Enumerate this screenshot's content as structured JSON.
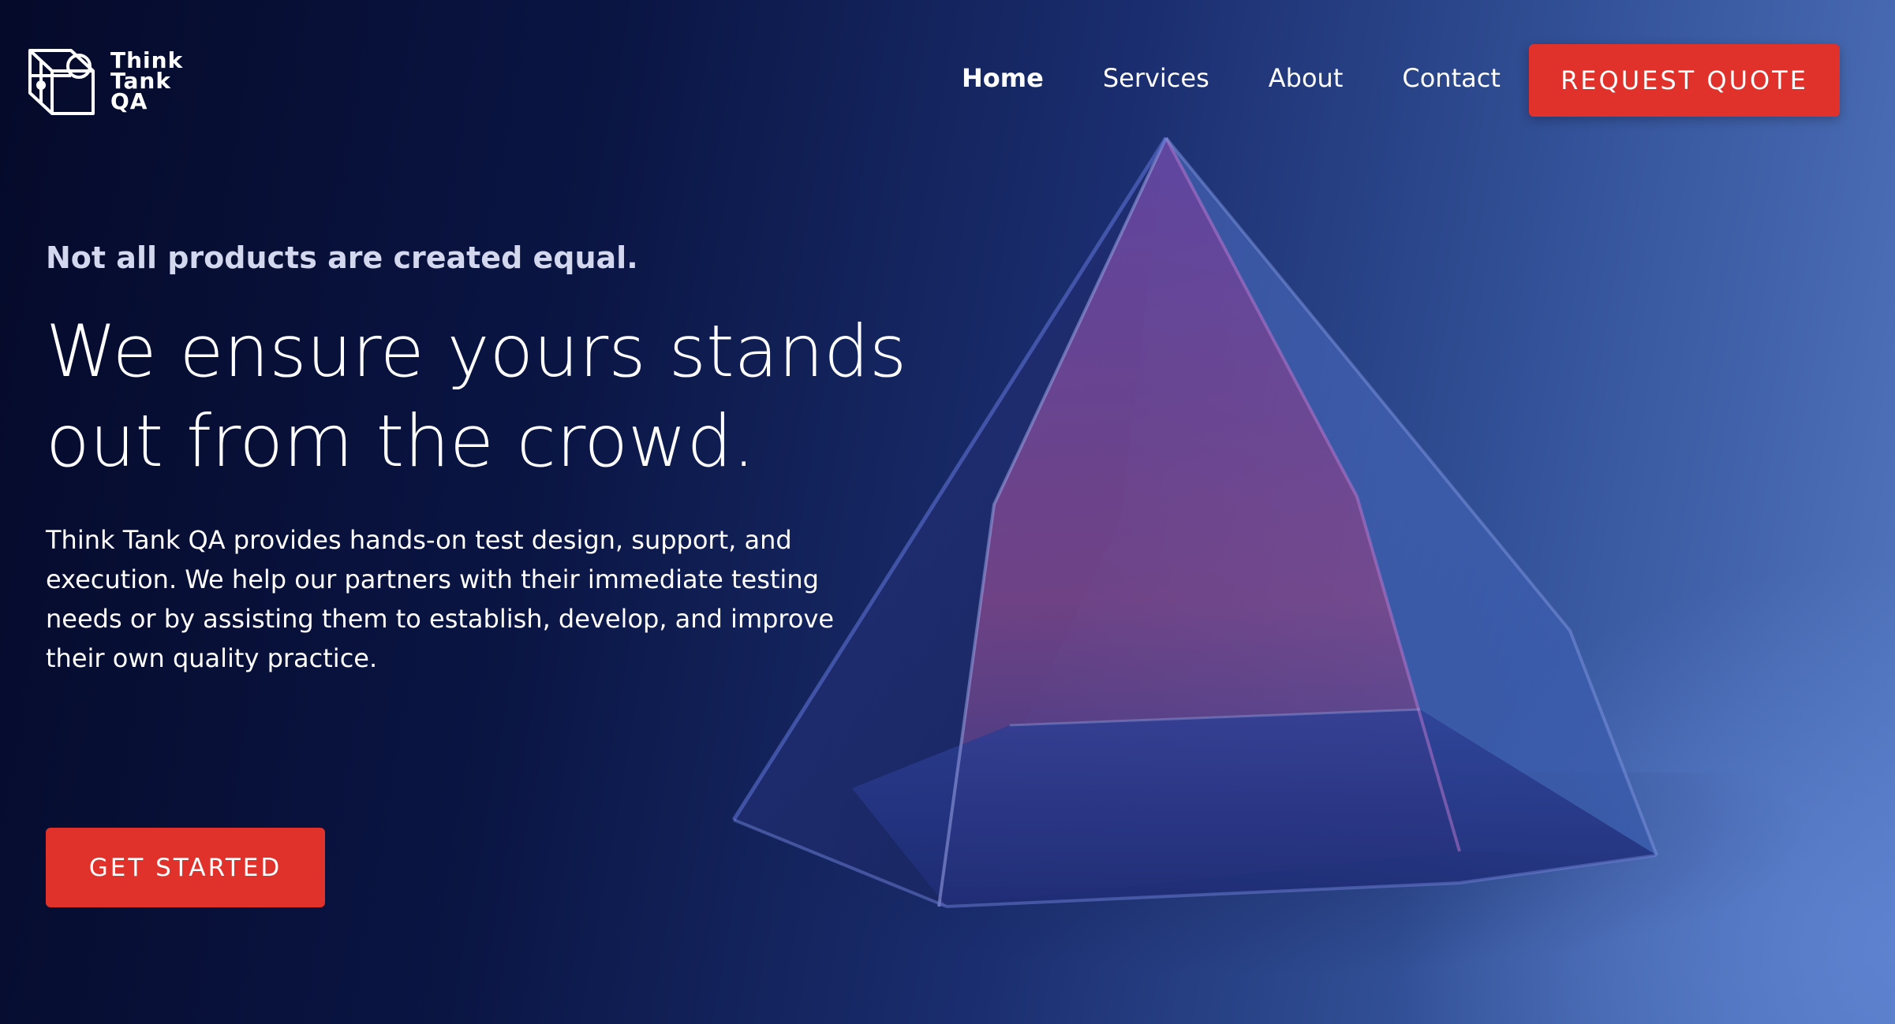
{
  "brand": {
    "name_lines": [
      "Think",
      "Tank",
      "QA"
    ],
    "logo_icon": "cube-logo-icon"
  },
  "nav": {
    "items": [
      {
        "label": "Home",
        "active": true
      },
      {
        "label": "Services",
        "active": false
      },
      {
        "label": "About",
        "active": false
      },
      {
        "label": "Contact",
        "active": false
      }
    ],
    "cta_label": "REQUEST QUOTE"
  },
  "hero": {
    "kicker": "Not all products are created equal.",
    "headline_lines": [
      "We ensure yours stands",
      "out from the crowd."
    ],
    "description": "Think Tank QA provides hands-on test design, support, and execution. We help our partners with their immediate testing needs or by assisting them to establish, develop, and improve their own quality practice.",
    "cta_label": "GET STARTED",
    "background_image": "glass-prism-image"
  },
  "colors": {
    "accent": "#e0312b",
    "background_dark": "#050a2a",
    "background_light": "#5377c0",
    "text": "#ffffff"
  }
}
